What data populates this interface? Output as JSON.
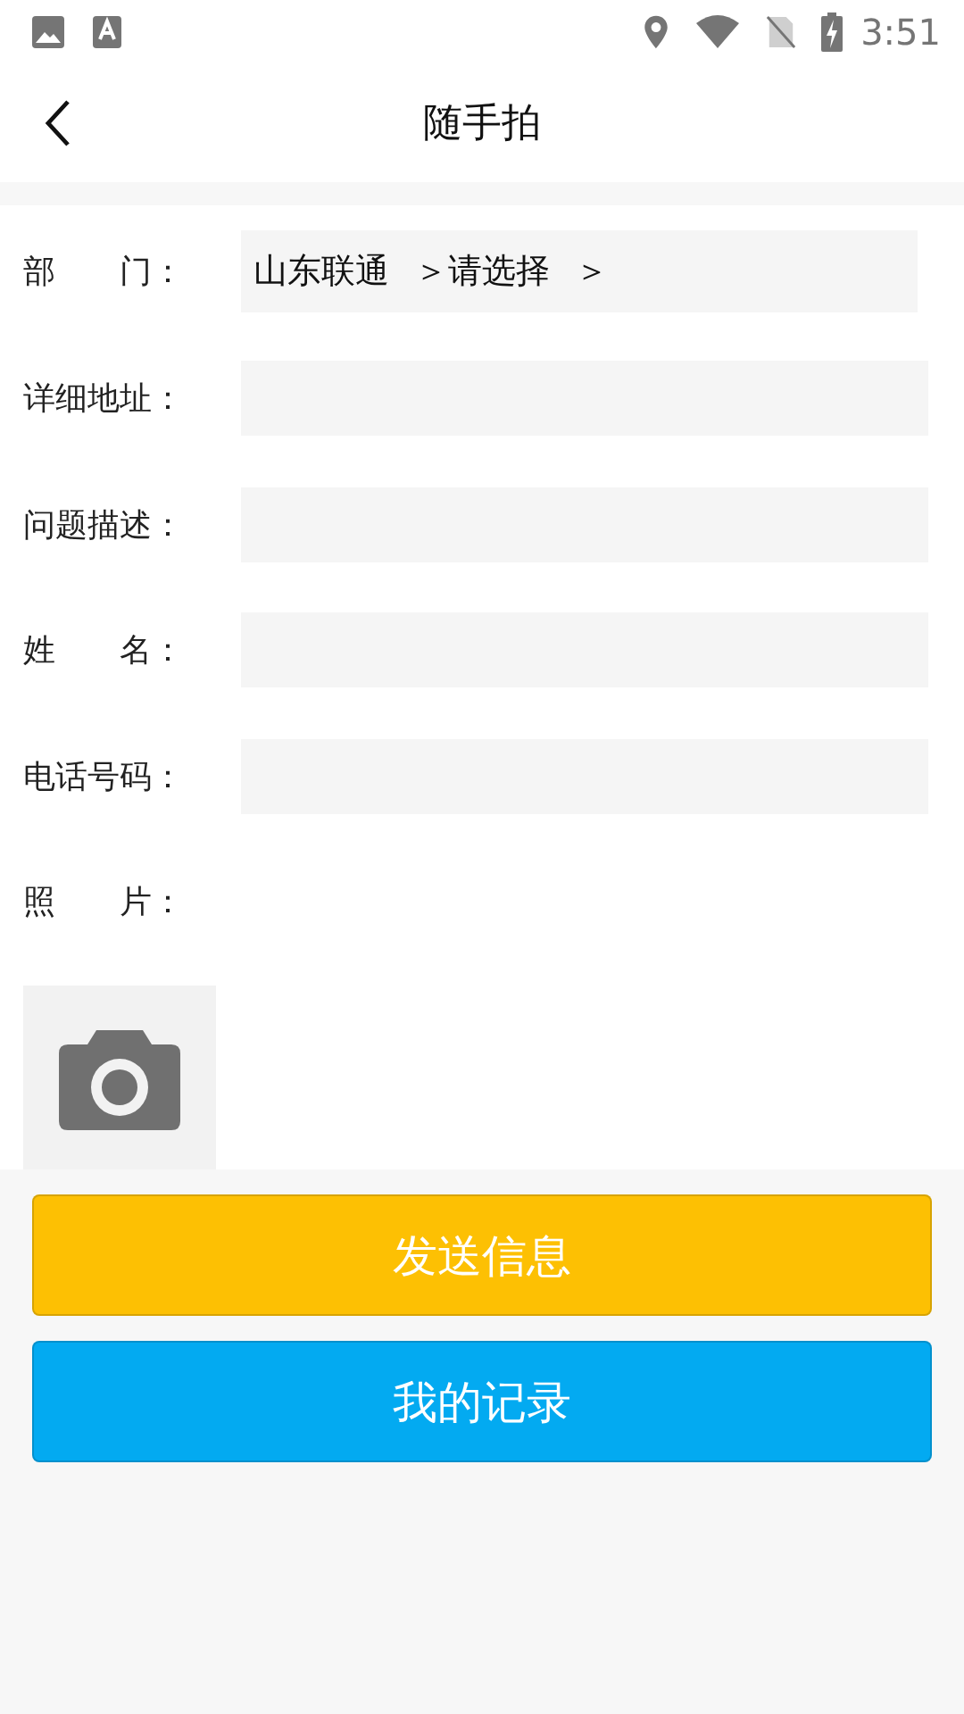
{
  "status_bar": {
    "time": "3:51"
  },
  "header": {
    "title": "随手拍"
  },
  "form": {
    "rows": [
      {
        "kind": "select",
        "label": "部　　门：",
        "segments": [
          "山东联通",
          "＞请选择",
          "＞"
        ]
      },
      {
        "kind": "input",
        "label": "详细地址："
      },
      {
        "kind": "input",
        "label": "问题描述："
      },
      {
        "kind": "input",
        "label": "姓　　名："
      },
      {
        "kind": "input",
        "label": "电话号码："
      },
      {
        "kind": "photo",
        "label": "照　　片："
      }
    ]
  },
  "buttons": [
    {
      "label": "发送信息",
      "color": "#fdc003"
    },
    {
      "label": "我的记录",
      "color": "#03aaf1"
    }
  ]
}
